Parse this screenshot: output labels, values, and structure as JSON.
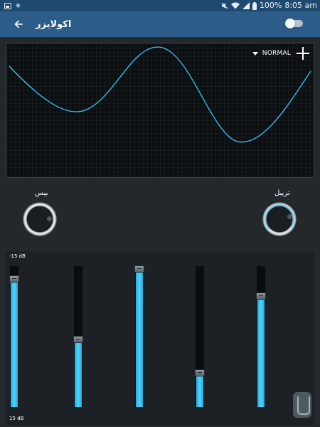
{
  "status_bar": {
    "percent": "100%",
    "time": "8:05 am"
  },
  "toolbar": {
    "title": "اکولایزر",
    "enabled": false
  },
  "curve": {
    "preset_label": "NORMAL"
  },
  "knobs": {
    "bass_label": "بیس",
    "treble_label": "تریبل"
  },
  "sliders": {
    "top_label": "-15 dB",
    "bottom_label": "15 dB",
    "bands": [
      {
        "fill_percent": 89
      },
      {
        "fill_percent": 46
      },
      {
        "fill_percent": 96
      },
      {
        "fill_percent": 22
      },
      {
        "fill_percent": 77
      }
    ]
  },
  "colors": {
    "accent": "#34c8f5",
    "toolbar": "#2b5d88",
    "status_bar": "#1f4a70",
    "background": "#23282d"
  }
}
